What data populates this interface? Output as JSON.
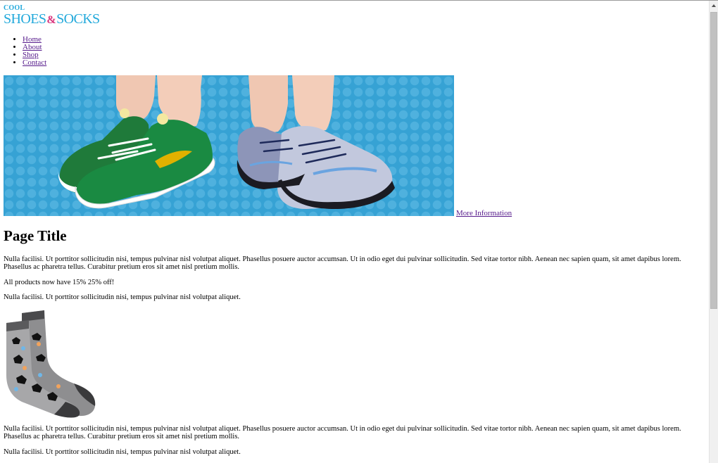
{
  "logo": {
    "cool": "COOL",
    "shoes": "SHOES",
    "amp": "&",
    "socks": "SOCKS",
    "colors": {
      "blue": "#22a9db",
      "pink": "#d8337c"
    }
  },
  "nav": [
    {
      "label": "Home"
    },
    {
      "label": "About"
    },
    {
      "label": "Shop"
    },
    {
      "label": "Contact"
    }
  ],
  "hero": {
    "more_link": "More Information",
    "background_color": "#36a2d4"
  },
  "content": {
    "title": "Page Title",
    "paragraph1": "Nulla facilisi. Ut porttitor sollicitudin nisi, tempus pulvinar nisl volutpat aliquet. Phasellus posuere auctor accumsan. Ut in odio eget dui pulvinar sollicitudin. Sed vitae tortor nibh. Aenean nec sapien quam, sit amet dapibus lorem. Phasellus ac pharetra tellus. Curabitur pretium eros sit amet nisl pretium mollis.",
    "promo": "All products now have 15% 25% off!",
    "paragraph2": "Nulla facilisi. Ut porttitor sollicitudin nisi, tempus pulvinar nisl volutpat aliquet.",
    "paragraph3": "Nulla facilisi. Ut porttitor sollicitudin nisi, tempus pulvinar nisl volutpat aliquet. Phasellus posuere auctor accumsan. Ut in odio eget dui pulvinar sollicitudin. Sed vitae tortor nibh. Aenean nec sapien quam, sit amet dapibus lorem. Phasellus ac pharetra tellus. Curabitur pretium eros sit amet nisl pretium mollis.",
    "paragraph4": "Nulla facilisi. Ut porttitor sollicitudin nisi, tempus pulvinar nisl volutpat aliquet."
  },
  "link_color": "#551a8b"
}
